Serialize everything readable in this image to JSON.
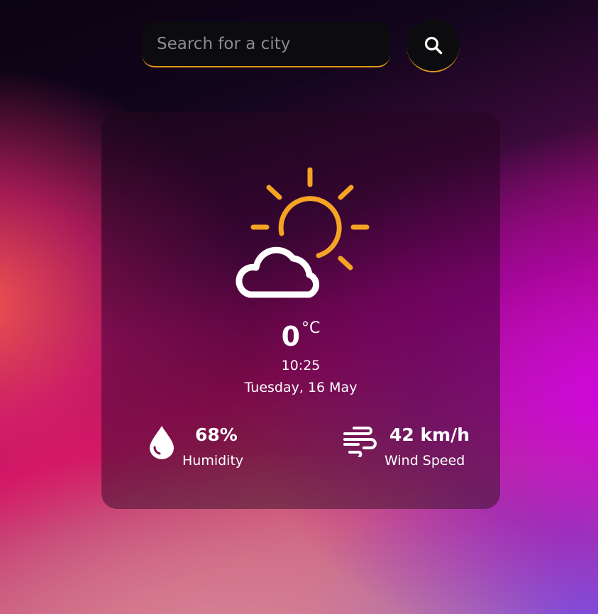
{
  "search": {
    "placeholder": "Search for a city",
    "value": "",
    "button_icon": "search-icon"
  },
  "weather": {
    "icon": "partly-cloudy-icon",
    "temperature": "0",
    "unit": "°C",
    "time": "10:25",
    "date": "Tuesday, 16 May"
  },
  "details": {
    "humidity": {
      "icon": "water-drop-icon",
      "value": "68%",
      "label": "Humidity"
    },
    "wind": {
      "icon": "wind-icon",
      "value": "42 km/h",
      "label": "Wind Speed"
    }
  },
  "colors": {
    "accent": "#e0951a",
    "sun": "#f4a324",
    "input_bg": "#0c0b0d",
    "text": "#ffffff"
  }
}
